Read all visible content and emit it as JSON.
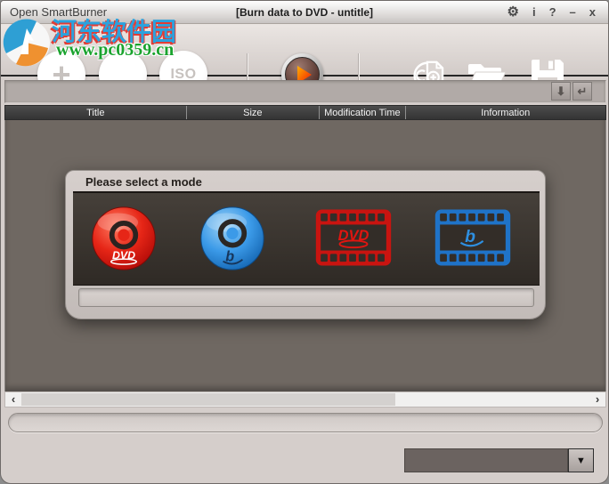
{
  "titlebar": {
    "app_title": "Open SmartBurner",
    "document_title": "[Burn data to DVD - untitle]",
    "icons": {
      "settings": "⚙",
      "info": "i",
      "help": "?",
      "minimize": "–",
      "close": "x"
    }
  },
  "toolbar": {
    "add_label": "+",
    "button2_label": "",
    "iso_label": "ISO",
    "icon_names": [
      "burn-play-icon",
      "disc-document-plus-icon",
      "open-folder-icon",
      "save-floppy-icon"
    ]
  },
  "path_bar": {
    "value": "",
    "down_arrow_icon": "⬇",
    "enter_icon": "↵"
  },
  "file_table": {
    "columns": [
      "Title",
      "Size",
      "Modification Time",
      "Information"
    ],
    "rows": []
  },
  "mode_dialog": {
    "title": "Please select a mode",
    "dvd_logo_text": "DVD",
    "modes": [
      {
        "id": "data-dvd",
        "icon": "dvd-disc-icon"
      },
      {
        "id": "data-bluray",
        "icon": "bluray-disc-icon"
      },
      {
        "id": "dvd-video",
        "icon": "dvd-film-icon"
      },
      {
        "id": "bluray-video",
        "icon": "bluray-film-icon"
      }
    ]
  },
  "scrollbar": {
    "left_icon": "‹",
    "right_icon": "›"
  },
  "status_bar": {
    "value": ""
  },
  "device_dropdown": {
    "value": "",
    "arrow_icon": "▼"
  },
  "watermark": {
    "site_name": "河东软件园",
    "site_url": "www.pc0359.cn"
  },
  "colors": {
    "dvd_red": "#d41512",
    "bluray_blue": "#3b9ae8",
    "film_blue": "#1f73c8",
    "table_header": "#3b3b3b",
    "table_body": "#6f6862",
    "window_frame": "#d5cecb",
    "dialog_dark": "#332d28",
    "watermark_blue": "#2ba2de",
    "watermark_red": "#e33c34",
    "watermark_green": "#1aa32e"
  }
}
